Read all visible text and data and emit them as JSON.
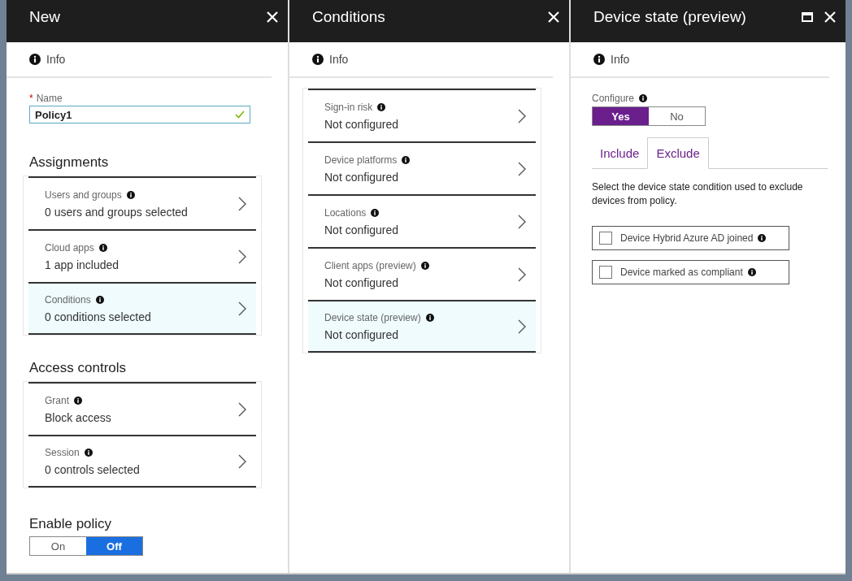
{
  "new_blade": {
    "title": "New",
    "info": "Info",
    "required_mark": "*",
    "name_label": "Name",
    "name_value": "Policy1",
    "name_valid": true,
    "assignments_heading": "Assignments",
    "assignments": [
      {
        "label": "Users and groups",
        "value": "0 users and groups selected",
        "selected": false
      },
      {
        "label": "Cloud apps",
        "value": "1 app included",
        "selected": false
      },
      {
        "label": "Conditions",
        "value": "0  conditions  selected",
        "selected": true
      }
    ],
    "access_heading": "Access controls",
    "access_controls": [
      {
        "label": "Grant",
        "value": "Block access",
        "selected": false
      },
      {
        "label": "Session",
        "value": "0 controls selected",
        "selected": false
      }
    ],
    "enable_label": "Enable policy",
    "enable_options": [
      {
        "label": "On",
        "selected": false
      },
      {
        "label": "Off",
        "selected": true
      }
    ]
  },
  "conditions_blade": {
    "title": "Conditions",
    "info": "Info",
    "items": [
      {
        "label": "Sign-in risk",
        "value": "Not configured",
        "selected": false
      },
      {
        "label": "Device platforms",
        "value": "Not configured",
        "selected": false
      },
      {
        "label": "Locations",
        "value": "Not configured",
        "selected": false
      },
      {
        "label": "Client apps (preview)",
        "value": "Not configured",
        "selected": false
      },
      {
        "label": "Device state (preview)",
        "value": "Not configured",
        "selected": true
      }
    ]
  },
  "device_state_blade": {
    "title": "Device state (preview)",
    "info": "Info",
    "configure_label": "Configure",
    "configure_options": [
      {
        "label": "Yes",
        "selected": true
      },
      {
        "label": "No",
        "selected": false
      }
    ],
    "tabs": [
      {
        "label": "Include",
        "selected": false
      },
      {
        "label": "Exclude",
        "selected": true
      }
    ],
    "description": "Select the device state condition used to exclude devices from policy.",
    "options": [
      {
        "label": "Device Hybrid Azure AD joined",
        "checked": false
      },
      {
        "label": "Device marked as compliant",
        "checked": false
      }
    ]
  }
}
